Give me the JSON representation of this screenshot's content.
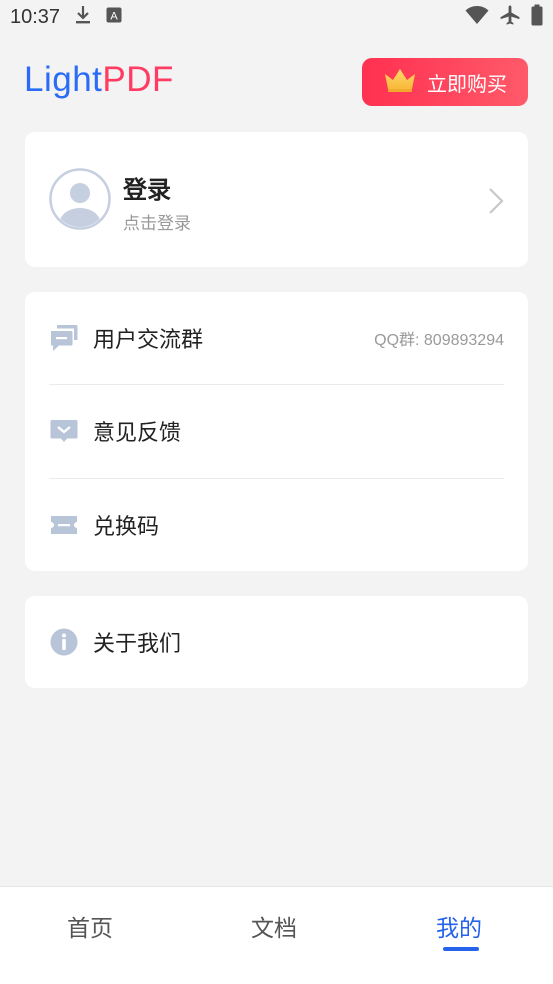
{
  "status_bar": {
    "time": "10:37",
    "left_icons": [
      "download-icon",
      "keyboard-icon"
    ],
    "right_icons": [
      "wifi-icon",
      "airplane-icon",
      "battery-icon"
    ]
  },
  "header": {
    "logo_light": "Light",
    "logo_pdf": "PDF",
    "buy_label": "立即购买",
    "buy_icon": "crown-icon"
  },
  "login": {
    "title": "登录",
    "subtitle": "点击登录"
  },
  "menu": {
    "items": [
      {
        "icon": "chat-group-icon",
        "label": "用户交流群",
        "extra": "QQ群: 809893294"
      },
      {
        "icon": "feedback-icon",
        "label": "意见反馈"
      },
      {
        "icon": "ticket-icon",
        "label": "兑换码"
      }
    ]
  },
  "about": {
    "icon": "info-icon",
    "label": "关于我们"
  },
  "tabbar": {
    "tabs": [
      {
        "label": "首页"
      },
      {
        "label": "文档"
      },
      {
        "label": "我的"
      }
    ],
    "active_index": 2
  },
  "colors": {
    "brand_blue": "#2b6cf6",
    "brand_pink": "#ff3b62",
    "buy_gradient_start": "#ff3050",
    "buy_gradient_end": "#ff5a6a",
    "icon_gray_blue": "#b8c4d8",
    "active_tab": "#2563eb"
  }
}
